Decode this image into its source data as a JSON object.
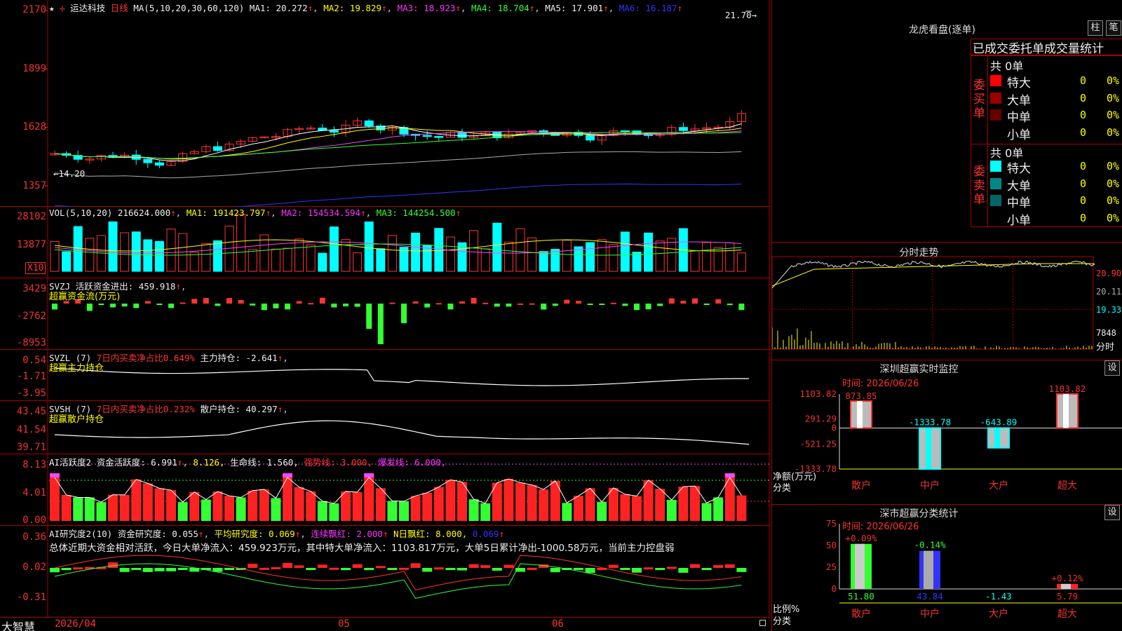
{
  "stock": {
    "name": "运达科技",
    "period": "日线"
  },
  "main_pane": {
    "ma_params": "MA(5,10,20,30,60,120)",
    "ma": [
      {
        "label": "MA1:",
        "value": "20.272",
        "color": "#ffffff"
      },
      {
        "label": "MA2:",
        "value": "19.829",
        "color": "#ffff00"
      },
      {
        "label": "MA3:",
        "value": "18.923",
        "color": "#ff44ff"
      },
      {
        "label": "MA4:",
        "value": "18.704",
        "color": "#33ff33"
      },
      {
        "label": "MA5:",
        "value": "17.901",
        "color": "#dddddd"
      },
      {
        "label": "MA6:",
        "value": "16.187",
        "color": "#3333ff"
      }
    ],
    "y_labels": [
      "2170",
      "1899",
      "1628",
      "1357"
    ],
    "high_marker": "21.70",
    "low_marker": "14.20"
  },
  "vol_pane": {
    "header": "VOL(5,10,20)",
    "value": "216624.000",
    "ma1": "MA1: 191423.797",
    "ma2": "MA2: 154534.594",
    "ma3": "MA3: 144254.500",
    "y_labels": [
      "28102",
      "13877"
    ],
    "scale": "X10"
  },
  "svzj_pane": {
    "name": "SVZJ",
    "label": "活跃资金进出: 459.918",
    "subtitle": "超赢资金流(万元)",
    "y_labels": [
      "3429",
      "-2762",
      "-8953"
    ]
  },
  "svzl_pane": {
    "name": "SVZL (7)",
    "ratio": "7日内买卖净占比0.649%",
    "label": "主力持仓: -2.641",
    "subtitle": "超赢主力持仓",
    "y_labels": [
      "0.54",
      "-1.71",
      "-3.95"
    ]
  },
  "svsh_pane": {
    "name": "SVSH (7)",
    "ratio": "7日内买卖净占比0.232%",
    "label": "散户持仓: 40.297",
    "subtitle": "超赢散户持仓",
    "y_labels": [
      "43.45",
      "41.54",
      "39.71"
    ]
  },
  "ai_active_pane": {
    "name": "AI活跃度2",
    "active": "资金活跃度: 6.991",
    "v2": "8.126,",
    "life": "生命线: 1.560,",
    "strong": "强势线: 3.000,",
    "burst": "爆发线: 6.000,",
    "y_labels": [
      "8.13",
      "4.01",
      "0.00"
    ]
  },
  "ai_research_pane": {
    "name": "AI研究度2(10)",
    "research": "资金研究度: 0.055",
    "avg": "平均研究度: 0.069",
    "streak": "连续飘红: 2.000",
    "n_red": "N日飘红: 8.000,",
    "n_val": "0.069",
    "summary": "总体近期大资金相对活跃，今日大单净流入：459.923万元，其中特大单净流入：1103.817万元，大单5日累计净出-1000.58万元，当前主力控盘弱",
    "y_labels": [
      "0.36",
      "0.02",
      "-0.31"
    ]
  },
  "bottom_bar": {
    "brand": "大智慧",
    "date_start": "2026/04",
    "month_05": "05",
    "month_06": "06"
  },
  "dragon_tiger": {
    "title": "龙虎看盘(逐单)",
    "btn_bar": "柱",
    "btn_stroke": "笔",
    "header": "已成交委托单成交量统计",
    "buy_label": "委买单",
    "sell_label": "委卖单",
    "buy_total": "共 0单",
    "sell_total": "共 0单",
    "buy_rows": [
      {
        "name": "特大",
        "count": "0",
        "pct": "0%",
        "color": "#ff0000"
      },
      {
        "name": "大单",
        "count": "0",
        "pct": "0%",
        "color": "#990000"
      },
      {
        "name": "中单",
        "count": "0",
        "pct": "0%",
        "color": "#660000"
      },
      {
        "name": "小单",
        "count": "0",
        "pct": "0%",
        "color": ""
      }
    ],
    "sell_rows": [
      {
        "name": "特大",
        "count": "0",
        "pct": "0%",
        "color": "#00ffff"
      },
      {
        "name": "大单",
        "count": "0",
        "pct": "0%",
        "color": "#008888"
      },
      {
        "name": "中单",
        "count": "0",
        "pct": "0%",
        "color": "#006666"
      },
      {
        "name": "小单",
        "count": "0",
        "pct": "0%",
        "color": ""
      }
    ]
  },
  "intraday": {
    "title": "分时走势",
    "y_labels": [
      "20.90",
      "20.11",
      "19.33",
      "7848"
    ],
    "unit": "分时"
  },
  "sz_monitor": {
    "title": "深圳超赢实时监控",
    "btn": "设",
    "time": "时间: 2026/06/26",
    "y_labels": [
      "1103.82",
      "291.29",
      "0",
      "-521.25",
      "-1333.78"
    ],
    "axis_title": "净额(万元)",
    "axis_sub": "分类",
    "categories": [
      "散户",
      "中户",
      "大户",
      "超大"
    ],
    "value_labels": [
      "873.85",
      "-1333.78",
      "-643.89",
      "1103.82"
    ]
  },
  "sz_class": {
    "title": "深市超赢分类统计",
    "btn": "设",
    "time": "时间: 2026/06/26",
    "y_labels": [
      "75",
      "50",
      "25",
      "0"
    ],
    "axis_title": "比例%",
    "axis_sub": "分类",
    "categories": [
      "散户",
      "中户",
      "大户",
      "超大"
    ],
    "top_labels": [
      "+0.09%",
      "-0.14%",
      "",
      "+0.12%"
    ],
    "bottom_labels": [
      "51.80",
      "43.84",
      "-1.43",
      "5.79"
    ]
  },
  "chart_data": [
    {
      "type": "candlestick",
      "title": "运达科技 日线",
      "ylim": [
        13.57,
        21.7
      ],
      "ma_last": {
        "MA1": 20.272,
        "MA2": 19.829,
        "MA3": 18.923,
        "MA4": 18.704,
        "MA5": 17.901,
        "MA6": 16.187
      },
      "high": 21.7,
      "low": 14.2
    },
    {
      "type": "bar",
      "title": "深圳超赢实时监控",
      "categories": [
        "散户",
        "中户",
        "大户",
        "超大"
      ],
      "values": [
        873.85,
        -1333.78,
        -643.89,
        1103.82
      ],
      "ylim": [
        -1333.78,
        1103.82
      ]
    },
    {
      "type": "bar",
      "title": "深市超赢分类统计",
      "categories": [
        "散户",
        "中户",
        "大户",
        "超大"
      ],
      "values": [
        51.8,
        43.84,
        -1.43,
        5.79
      ],
      "change": [
        "+0.09%",
        "-0.14%",
        "",
        "+0.12%"
      ],
      "ylim": [
        0,
        75
      ]
    }
  ]
}
